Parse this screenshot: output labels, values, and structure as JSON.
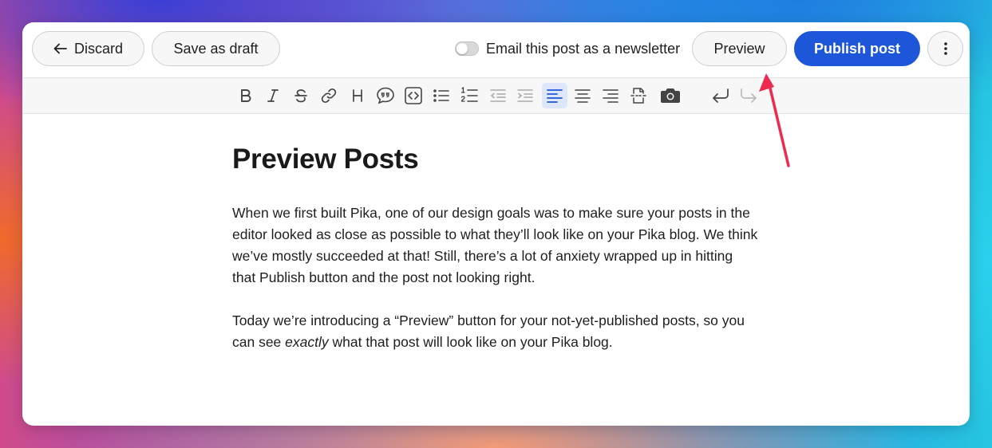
{
  "topbar": {
    "discard_label": "Discard",
    "save_draft_label": "Save as draft",
    "newsletter_label": "Email this post as a newsletter",
    "newsletter_enabled": false,
    "preview_label": "Preview",
    "publish_label": "Publish post"
  },
  "toolbar": {
    "buttons": [
      "bold",
      "italic",
      "strikethrough",
      "link",
      "heading",
      "quote",
      "code",
      "bullet-list",
      "numbered-list",
      "outdent",
      "indent",
      "align-left",
      "align-center",
      "align-right",
      "page-break",
      "camera",
      "undo",
      "redo"
    ],
    "active": "align-left"
  },
  "colors": {
    "accent": "#1d56d8",
    "active_tool_bg": "#dde6fb",
    "annotation_arrow": "#ee2a4f"
  },
  "post": {
    "title": "Preview Posts",
    "p1": "When we first built Pika, one of our design goals was to make sure your posts in the editor looked as close as possible to what they’ll look like on your Pika blog. We think we’ve mostly succeeded at that! Still, there’s a lot of anxiety wrapped up in hitting that Publish button and the post not looking right.",
    "p2_before": "Today we’re introducing a “Preview” button for your not-yet-published posts, so you can see ",
    "p2_em": "exactly",
    "p2_after": " what that post will look like on your Pika blog."
  }
}
